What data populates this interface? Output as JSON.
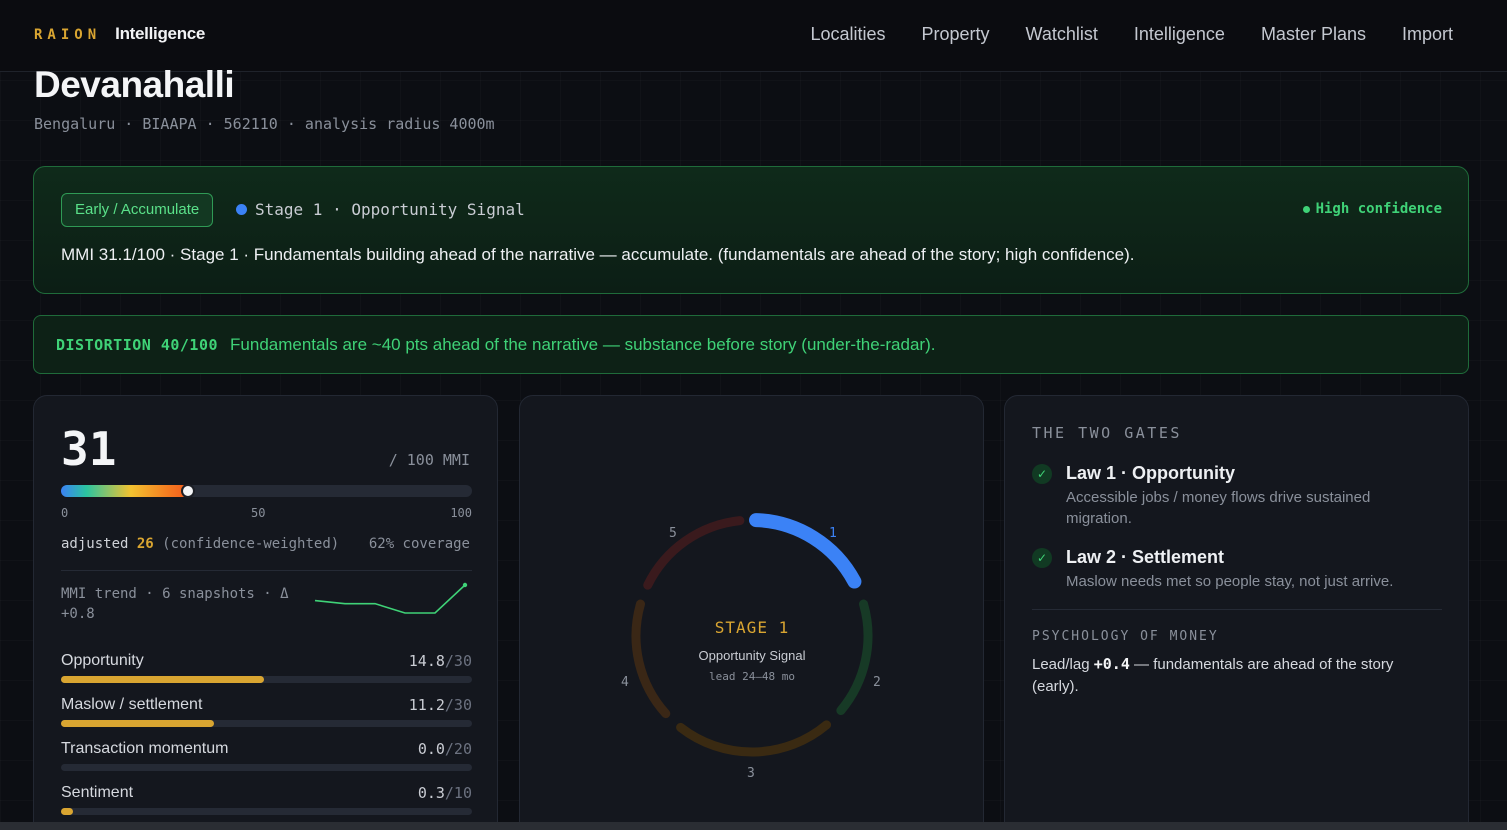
{
  "brand": {
    "mark": "RAION",
    "name": "Intelligence"
  },
  "nav": [
    "Localities",
    "Property",
    "Watchlist",
    "Intelligence",
    "Master Plans",
    "Import"
  ],
  "header": {
    "title": "Devanahalli",
    "subtitle": "Bengaluru · BIAAPA · 562110 · analysis radius 4000m"
  },
  "status": {
    "pill": "Early / Accumulate",
    "stage": "Stage 1 · Opportunity Signal",
    "confidence": "High confidence",
    "text": "MMI 31.1/100 · Stage 1 · Fundamentals building ahead of the narrative — accumulate. (fundamentals are ahead of the story; high confidence)."
  },
  "distortion": {
    "label": "DISTORTION 40/100",
    "text": "Fundamentals are ~40 pts ahead of the narrative — substance before story (under-the-radar)."
  },
  "mmi": {
    "score": "31",
    "score_value": 31,
    "scale": "/ 100 MMI",
    "ticks": [
      "0",
      "50",
      "100"
    ],
    "adjusted_label": "adjusted",
    "adjusted_value": "26",
    "adjusted_note": "(confidence-weighted)",
    "coverage": "62% coverage",
    "trend_label": "MMI trend · 6 snapshots · Δ +0.8",
    "trend_values": [
      30.6,
      30.5,
      30.5,
      30.2,
      30.2,
      31.1
    ],
    "metrics": [
      {
        "label": "Opportunity",
        "value": "14.8",
        "max": "/30",
        "frac": 0.493
      },
      {
        "label": "Maslow / settlement",
        "value": "11.2",
        "max": "/30",
        "frac": 0.373
      },
      {
        "label": "Transaction momentum",
        "value": "0.0",
        "max": "/20",
        "frac": 0
      },
      {
        "label": "Sentiment",
        "value": "0.3",
        "max": "/10",
        "frac": 0.03
      }
    ]
  },
  "stage_dial": {
    "stage_title": "STAGE 1",
    "stage_name": "Opportunity Signal",
    "lead": "lead 24–48 mo",
    "labels": [
      "1",
      "2",
      "3",
      "4",
      "5"
    ],
    "colors": {
      "active": "#3b82f6",
      "s2": "#173a26",
      "s3": "#3a2a12",
      "s4": "#3a2716",
      "s5": "#3a1a1d"
    }
  },
  "gates": {
    "title": "THE TWO GATES",
    "laws": [
      {
        "title": "Law 1 · Opportunity",
        "desc": "Accessible jobs / money flows drive sustained migration."
      },
      {
        "title": "Law 2 · Settlement",
        "desc": "Maslow needs met so people stay, not just arrive."
      }
    ],
    "psy_title": "PSYCHOLOGY OF MONEY",
    "psy_prefix": "Lead/lag",
    "psy_value": "+0.4",
    "psy_suffix": "— fundamentals are ahead of the story (early)."
  }
}
